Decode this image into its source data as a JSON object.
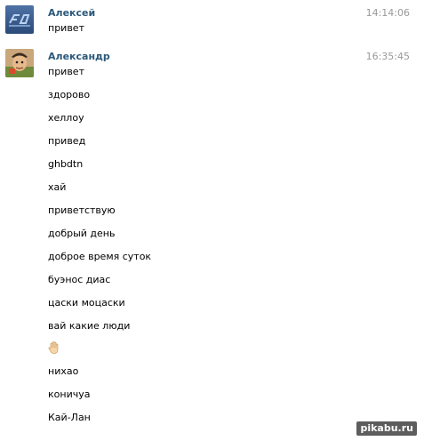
{
  "messages": [
    {
      "author": "Алексей",
      "time": "14:14:06",
      "avatar": "avatar-logo-blue",
      "lines": [
        "привет"
      ]
    },
    {
      "author": "Александр",
      "time": "16:35:45",
      "avatar": "avatar-cartoon",
      "lines": [
        "привет",
        "здорово",
        "хеллоу",
        "привед",
        "ghbdtn",
        "хай",
        "приветствую",
        "добрый день",
        "доброе время суток",
        "буэнос диас",
        "цаски моцаски",
        "вай какие люди",
        "",
        "нихао",
        "коничуа",
        "Кай-Лан"
      ],
      "emoji_line_icon": "raised-hand-icon"
    }
  ],
  "watermark": "pikabu.ru",
  "colors": {
    "author": "#2b587a",
    "time": "#999999",
    "text": "#000000",
    "watermark_bg": "#5d5d5d"
  }
}
